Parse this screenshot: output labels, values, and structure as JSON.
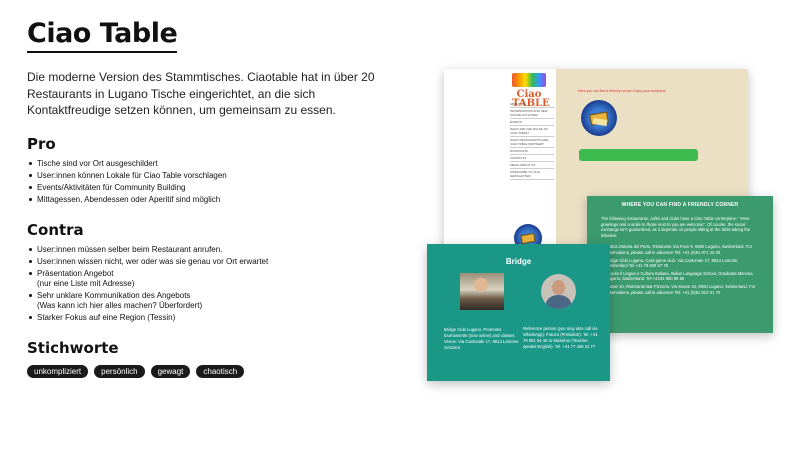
{
  "title": "Ciao Table",
  "intro": "Die moderne Version des Stammtisches. Ciaotable hat in über 20 Restaurants in Lugano Tische eingerichtet, an die sich Kontaktfreudige setzen können, um gemeinsam zu essen.",
  "pro": {
    "heading": "Pro",
    "items": [
      "Tische sind vor Ort ausgeschildert",
      "User:innen können Lokale für Ciao Table vorschlagen",
      "Events/Aktivitäten für Community Building",
      "Mittagessen, Abendessen oder Aperitif sind möglich"
    ]
  },
  "contra": {
    "heading": "Contra",
    "items": [
      "User:innen müssen selber beim Restaurant anrufen.",
      "User:innen wissen nicht, wer oder was sie genau vor Ort erwartet",
      "Präsentation Angebot",
      "(nur eine Liste mit Adresse)",
      "Sehr unklare Kommunikation des Angebots",
      "(Was kann ich hier alles machen? Überfordert)",
      "Starker Fokus auf eine Region (Tessin)"
    ]
  },
  "keywords": {
    "heading": "Stichworte",
    "tags": [
      "unkompliziert",
      "persönlich",
      "gewagt",
      "chaotisch"
    ]
  },
  "screens": {
    "site": {
      "logo": "Ciao TABLE",
      "nav": [
        "ABOUT US",
        "INFORMATIONS AND NEW ONLINE ACTIVITIES",
        "EVENTS",
        "WHAT ARE THE RULES OF CIAO TABLE?",
        "WHAT RESTAURANTS ARE CIAO TABLE PARTNER?",
        "DONATIONS",
        "CONTACTS",
        "MEDIA ABOUT US",
        "SUBSCRIBE TO OUR NEWSLETTER"
      ],
      "red_text": "Here you can find a friendly corner. Enjoy your company!"
    },
    "corner": {
      "heading": "WHERE YOU CAN FIND A FRIENDLY CORNER",
      "text": "The following restaurants, cafés and clubs have a Ciao Table centrepiece: \"Here greetings and a smile to those next to you are welcome\". Of course, the social exchange isn't guaranteed, as it depends on people sitting at the table taking the initiative:",
      "items": [
        "Antica Osteria del Porto, Ristorante Via Foce 9, 6900 Lugano, Switzerland. For reservations, please call in advance! Tel: +41 (0)91 971 42 00",
        "Bridge Club Lugano, Card game club. Via Cantonale 17, 6814 Lamone, Switzerland Tel +41 79 606 67 78",
        "Scuola Il Lingue e Cultura Italiana, Italian Language School, Gradinata Mimosa, Lugano, Switzerland. Tel +4191 950 86 86",
        "Soave 10, Ristorante Bar Pizzeria. Via Soave 10, 6900 Lugano, Switzerland. For reservations, please call in advance! Tel: +41 (0)91 922 01 70"
      ]
    },
    "bridge": {
      "heading": "Bridge",
      "left_text": "Bridge Club Lugano. Promotes tournaments (now online) and classes. Venue: Via Cantonale 17, 6814 Lamone. Svizzera",
      "right_text": "Reference person (you may also call via WhatsApp): Franco (President). Tel. +41 79 881 54 40 or Massimo (Teacher, speaks English). Tel. +41 77 436 31 77"
    }
  },
  "colors": {
    "site_bg": "#ebe0c4",
    "corner_bg": "#3b9a6e",
    "bridge_bg": "#1b9788",
    "chat_bubble": "#3dbb4e"
  }
}
